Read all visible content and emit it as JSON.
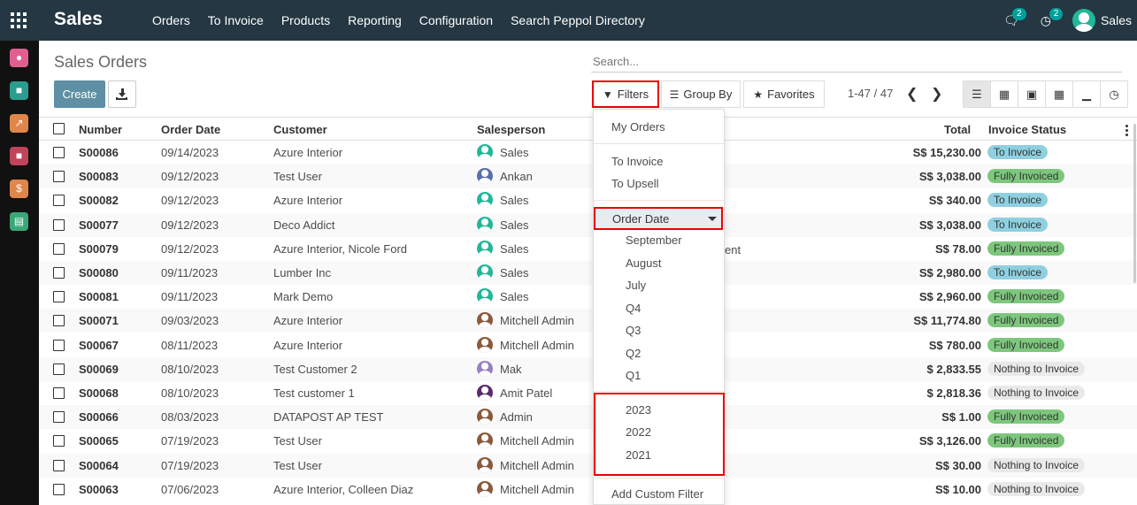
{
  "app": {
    "title": "Sales"
  },
  "menu": [
    "Orders",
    "To Invoice",
    "Products",
    "Reporting",
    "Configuration",
    "Search Peppol Directory"
  ],
  "systray": {
    "messages_count": "2",
    "activities_count": "2",
    "user": "Sales"
  },
  "breadcrumb": "Sales Orders",
  "search": {
    "placeholder": "Search..."
  },
  "buttons": {
    "create": "Create",
    "filters": "Filters",
    "group_by": "Group By",
    "favorites": "Favorites"
  },
  "pager": {
    "text": "1-47 / 47"
  },
  "columns": {
    "number": "Number",
    "order_date": "Order Date",
    "customer": "Customer",
    "salesperson": "Salesperson",
    "total": "Total",
    "invoice_status": "Invoice Status"
  },
  "rows": [
    {
      "number": "S00086",
      "date": "09/14/2023",
      "customer": "Azure Interior",
      "salesperson": "Sales",
      "total": "S$ 15,230.00",
      "status": "To Invoice"
    },
    {
      "number": "S00083",
      "date": "09/12/2023",
      "customer": "Test User",
      "salesperson": "Ankan",
      "total": "S$ 3,038.00",
      "status": "Fully Invoiced"
    },
    {
      "number": "S00082",
      "date": "09/12/2023",
      "customer": "Azure Interior",
      "salesperson": "Sales",
      "total": "S$ 340.00",
      "status": "To Invoice"
    },
    {
      "number": "S00077",
      "date": "09/12/2023",
      "customer": "Deco Addict",
      "salesperson": "Sales",
      "total": "S$ 3,038.00",
      "status": "To Invoice"
    },
    {
      "number": "S00079",
      "date": "09/12/2023",
      "customer": "Azure Interior, Nicole Ford",
      "salesperson": "Sales",
      "total": "S$ 78.00",
      "status": "Fully Invoiced"
    },
    {
      "number": "S00080",
      "date": "09/11/2023",
      "customer": "Lumber Inc",
      "salesperson": "Sales",
      "total": "S$ 2,980.00",
      "status": "To Invoice"
    },
    {
      "number": "S00081",
      "date": "09/11/2023",
      "customer": "Mark Demo",
      "salesperson": "Sales",
      "total": "S$ 2,960.00",
      "status": "Fully Invoiced"
    },
    {
      "number": "S00071",
      "date": "09/03/2023",
      "customer": "Azure Interior",
      "salesperson": "Mitchell Admin",
      "total": "S$ 11,774.80",
      "status": "Fully Invoiced"
    },
    {
      "number": "S00067",
      "date": "08/11/2023",
      "customer": "Azure Interior",
      "salesperson": "Mitchell Admin",
      "total": "S$ 780.00",
      "status": "Fully Invoiced"
    },
    {
      "number": "S00069",
      "date": "08/10/2023",
      "customer": "Test Customer 2",
      "salesperson": "Mak",
      "total": "$ 2,833.55",
      "status": "Nothing to Invoice"
    },
    {
      "number": "S00068",
      "date": "08/10/2023",
      "customer": "Test customer 1",
      "salesperson": "Amit Patel",
      "total": "$ 2,818.36",
      "status": "Nothing to Invoice"
    },
    {
      "number": "S00066",
      "date": "08/03/2023",
      "customer": "DATAPOST AP TEST",
      "salesperson": "Admin",
      "total": "S$ 1.00",
      "status": "Fully Invoiced"
    },
    {
      "number": "S00065",
      "date": "07/19/2023",
      "customer": "Test User",
      "salesperson": "Mitchell Admin",
      "total": "S$ 3,126.00",
      "status": "Fully Invoiced"
    },
    {
      "number": "S00064",
      "date": "07/19/2023",
      "customer": "Test User",
      "salesperson": "Mitchell Admin",
      "total": "S$ 30.00",
      "status": "Nothing to Invoice"
    },
    {
      "number": "S00063",
      "date": "07/06/2023",
      "customer": "Azure Interior, Colleen Diaz",
      "salesperson": "Mitchell Admin",
      "total": "S$ 10.00",
      "status": "Nothing to Invoice"
    }
  ],
  "hidden_text_fragment": "ent",
  "filters_dropdown": {
    "my_orders": "My Orders",
    "to_invoice": "To Invoice",
    "to_upsell": "To Upsell",
    "order_date": "Order Date",
    "periods": [
      "September",
      "August",
      "July",
      "Q4",
      "Q3",
      "Q2",
      "Q1"
    ],
    "years": [
      "2023",
      "2022",
      "2021"
    ],
    "add_custom_filter": "Add Custom Filter"
  },
  "colors": {
    "navbar": "#243742",
    "to_invoice": "#8fd0e0",
    "fully_invoiced": "#7dc77d",
    "nothing_to_invoice": "#e9e9e9",
    "highlight": "#e00000"
  }
}
